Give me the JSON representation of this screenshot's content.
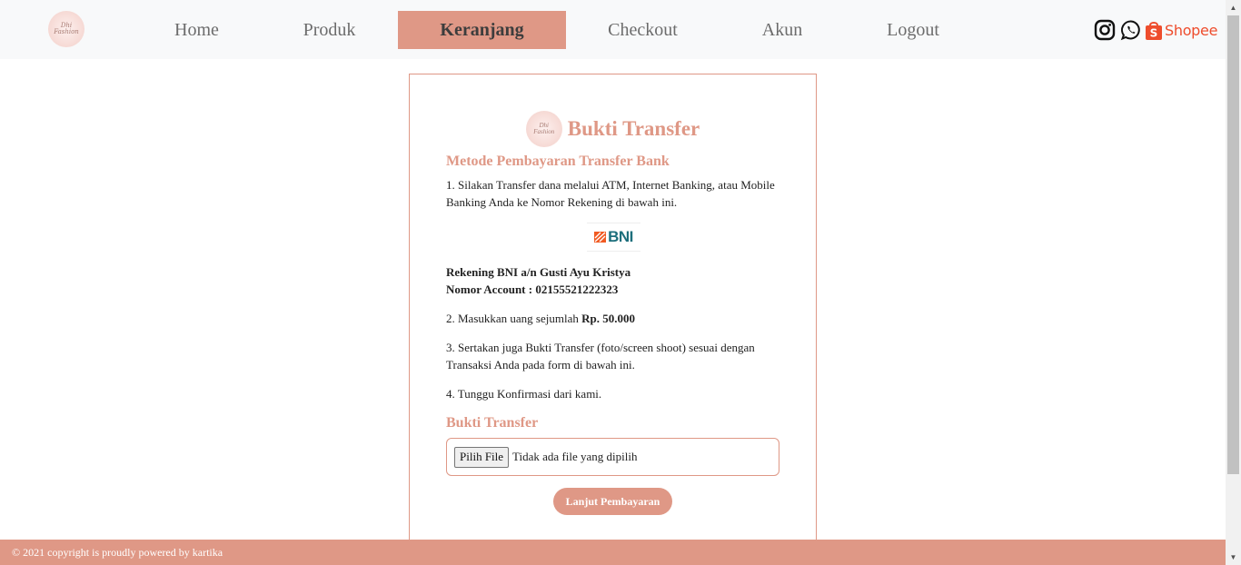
{
  "navbar": {
    "logo_text": "Dhi Fashion",
    "links": [
      {
        "label": "Home",
        "active": false
      },
      {
        "label": "Produk",
        "active": false
      },
      {
        "label": "Keranjang",
        "active": true
      },
      {
        "label": "Checkout",
        "active": false
      },
      {
        "label": "Akun",
        "active": false
      },
      {
        "label": "Logout",
        "active": false
      }
    ],
    "social": {
      "instagram_icon": "instagram-icon",
      "whatsapp_icon": "whatsapp-icon",
      "shopee_label": "Shopee"
    }
  },
  "card": {
    "logo_text": "Dhi Fashion",
    "title": "Bukti Transfer",
    "method_title": "Metode Pembayaran Transfer Bank",
    "step1": "1. Silakan Transfer dana melalui ATM, Internet Banking, atau Mobile Banking Anda ke Nomor Rekening di bawah ini.",
    "bank_logo": "BNI",
    "account_name": "Rekening BNI a/n Gusti Ayu Kristya",
    "account_number": "Nomor Account : 02155521222323",
    "step2_prefix": "2. Masukkan uang sejumlah ",
    "step2_amount": "Rp. 50.000",
    "step3": "3. Sertakan juga Bukti Transfer (foto/screen shoot) sesuai dengan Transaksi Anda pada form di bawah ini.",
    "step4": "4. Tunggu Konfirmasi dari kami.",
    "upload_title": "Bukti Transfer",
    "file_button": "Pilih File",
    "file_status": "Tidak ada file yang dipilih",
    "submit_label": "Lanjut Pembayaran"
  },
  "footer": {
    "text": "© 2021 copyright is proudly powered by kartika"
  },
  "colors": {
    "accent": "#df9886",
    "navbar_bg": "#f8f9fa",
    "bni_teal": "#1d6f7c",
    "bni_orange": "#f15a22",
    "shopee_orange": "#ee4d2d"
  }
}
